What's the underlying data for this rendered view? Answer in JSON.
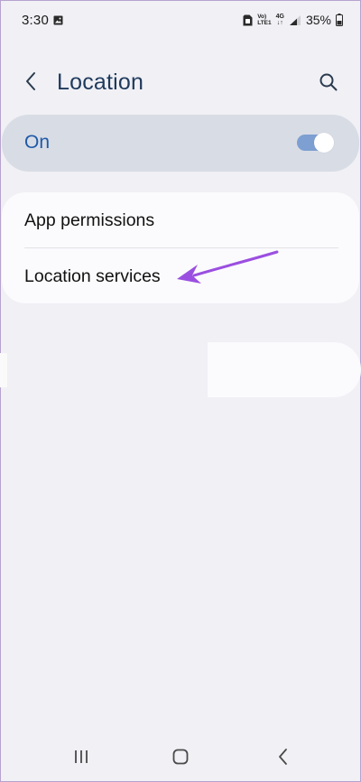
{
  "status_bar": {
    "time": "3:30",
    "volte_top": "Vo)",
    "volte_bottom": "LTE1",
    "network_top": "4G",
    "network_bottom": "↓↑",
    "battery_percent": "35%"
  },
  "header": {
    "title": "Location"
  },
  "master_toggle": {
    "label": "On",
    "state": true
  },
  "menu": {
    "items": [
      {
        "label": "App permissions"
      },
      {
        "label": "Location services"
      }
    ]
  },
  "colors": {
    "background": "#f0f0f5",
    "title": "#1f3a5c",
    "toggle_label": "#1e5aa8",
    "switch_track": "#7d9fd2",
    "annotation_arrow": "#9b4fe0"
  },
  "icons": {
    "back": "back-chevron-icon",
    "search": "search-icon",
    "nav_recents": "recent-apps-icon",
    "nav_home": "home-icon",
    "nav_back": "back-icon"
  }
}
